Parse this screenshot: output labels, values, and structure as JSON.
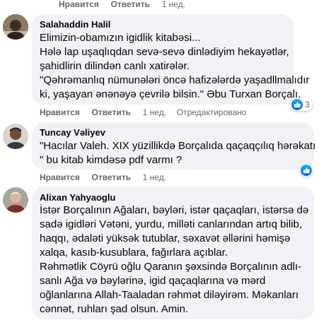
{
  "top_actions": {
    "like": "Нравится",
    "reply": "Ответить",
    "time": "1 нед."
  },
  "comments": [
    {
      "author": "Salahaddin Halil",
      "lines": [
        "Elimizin-obamızın igidlik kitabəsi...",
        "Hələ lap uşaqlıqdan sevə-sevə dinlədiyim hekayətlər,",
        "şahidlirin dilindən canlı xatirələr.",
        "\"Qəhrəmanlıq nümunələri öncə hafizələrdə yaşadllmalıdır",
        "ki, yaşayan ənənəyə çevrilə bilsin.\" Əbu Turxan Borçalı."
      ],
      "reactions": "3",
      "actions": {
        "like": "Нравится",
        "reply": "Ответить",
        "time": "1 нед.",
        "edited": "Отредактировано"
      }
    },
    {
      "author": "Tuncay Vəliyev",
      "lines": [
        "\"Hacılar Valeh. XIX yüzillikdə Borçalıda qaçaqçılıq hərəkatı",
        "\" bu kitab kimdəsə pdf varmı ?"
      ],
      "actions": {
        "like": "Нравится",
        "reply": "Ответить",
        "time": "1 нед."
      }
    },
    {
      "author": "Alixan Yahyaoglu",
      "lines": [
        "İstər Borçalının Ağaları, bəyləri, istər qaçaqları, istərsə də",
        "sadə igidləri Vətəni, yurdu, milləti canlarından artıq bilib,",
        "haqqı, ədaləti yüksək tutublar, səxavət əllərini həmişə",
        "xalqa, kasıb-kusublara, fağırlara açıblar.",
        "Rəhmətlik Cöyrü oğlu Qaranın şəxsində Borçalının adlı-",
        "sanlı Ağa və bəylərinə, igid qaçaqlarına və mərd",
        "oğlanlarına Allah-Taaladan rəhmət diləyirəm. Məkanları",
        "cənnət, ruhları şad olsun. Amin."
      ]
    }
  ],
  "colors": {
    "bubble": "#f0f2f5",
    "action_text": "#65676b",
    "like_blue": "#1877f2"
  }
}
